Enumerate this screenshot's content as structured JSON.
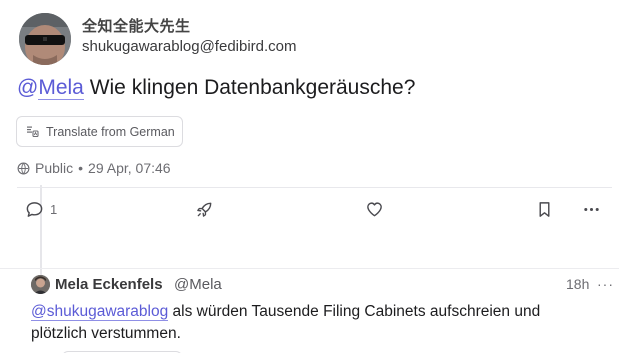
{
  "post": {
    "display_name": "全知全能大先生",
    "handle": "shukugawarablog@fedibird.com",
    "mention_at": "@",
    "mention_name": "Mela",
    "content_text": " Wie klingen Datenbankgeräusche?",
    "translate_label": "Translate from German",
    "visibility": "Public",
    "separator": "•",
    "timestamp": "29 Apr, 07:46",
    "reply_count": "1",
    "icons": {
      "translate": "translate-icon",
      "visibility": "globe-icon",
      "reply": "reply-bubble-icon",
      "boost": "rocket-icon",
      "favourite": "heart-icon",
      "bookmark": "bookmark-icon",
      "more": "more-icon"
    }
  },
  "reply": {
    "display_name": "Mela Eckenfels",
    "handle": "@Mela",
    "time": "18h",
    "more": "···",
    "mention": "@shukugawarablog",
    "text": " als würden Tausende Filing Cabinets aufschreien und plötzlich verstummen."
  },
  "colors": {
    "accent": "#5b5bd6",
    "muted": "#6d6d72",
    "border": "#dcdce0"
  }
}
